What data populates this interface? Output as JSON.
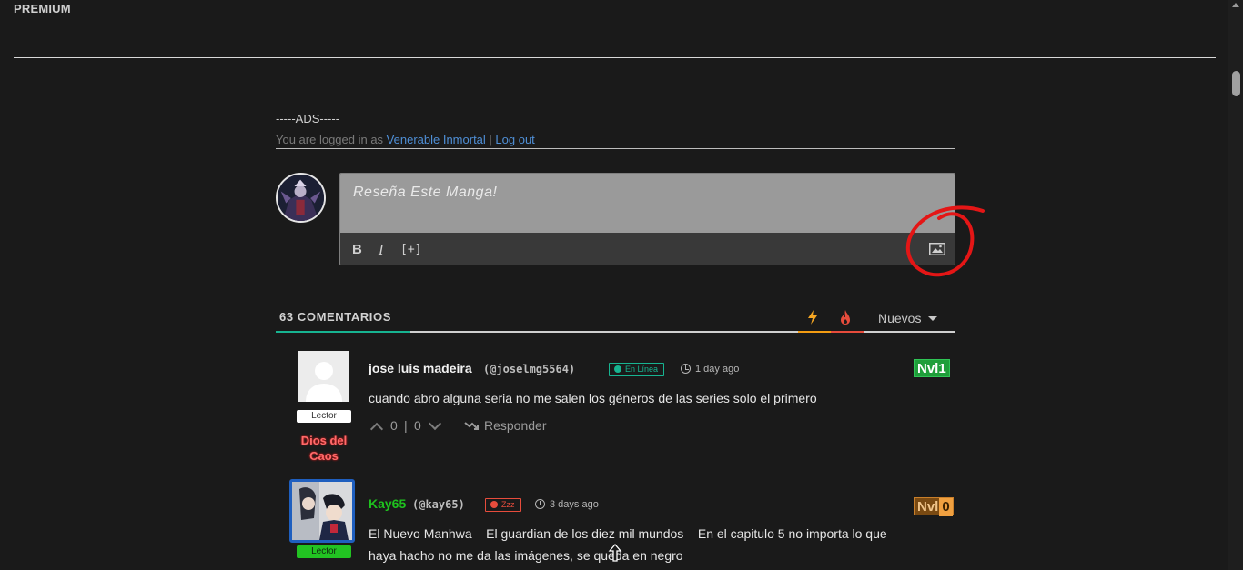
{
  "header": {
    "premium_label": "PREMIUM"
  },
  "ads_label": "-----ADS-----",
  "login": {
    "prefix": "You are logged in as ",
    "username": "Venerable Inmortal",
    "separator": " | ",
    "logout": "Log out"
  },
  "composer": {
    "placeholder": "Reseña Este Manga!",
    "tools": {
      "bold": "B",
      "italic": "I",
      "spoiler": "[+]"
    }
  },
  "comments_header": {
    "count_label": "63 COMENTARIOS",
    "sort_selected": "Nuevos"
  },
  "comments": [
    {
      "name": "jose luis madeira",
      "handle": "(@joselmg5564)",
      "status": "En Línea",
      "time": "1 day ago",
      "level": "Nvl1",
      "badge": "Lector",
      "rank_title": "Dios del Caos",
      "text": "cuando abro alguna seria no me salen los géneros de las series solo el primero",
      "upvotes": "0",
      "downvotes": "0",
      "reply_label": "Responder"
    },
    {
      "name": "Kay65",
      "handle": "(@kay65)",
      "status": "Zzz",
      "time": "3 days ago",
      "level_prefix": "Nvl",
      "level_num": "0",
      "badge": "Lector",
      "text_line1": "El Nuevo Manhwa – El guardian de los diez mil mundos – En el capitulo 5 no importa lo que",
      "text_line2": "haya hacho no me da las imágenes, se queda en negro"
    }
  ],
  "colors": {
    "background": "#1a1a1a",
    "link": "#4f8fd6",
    "accent_teal": "#17b491",
    "online_green": "#17b491",
    "away_red": "#e74c3c",
    "rank_red": "#ff6b6b",
    "kay_green": "#22c322"
  },
  "icons": [
    "bold-icon",
    "italic-icon",
    "spoiler-icon",
    "image-upload-icon",
    "bolt-icon",
    "fire-icon",
    "clock-icon",
    "upvote-chevron-icon",
    "downvote-chevron-icon",
    "reply-arrow-icon"
  ]
}
